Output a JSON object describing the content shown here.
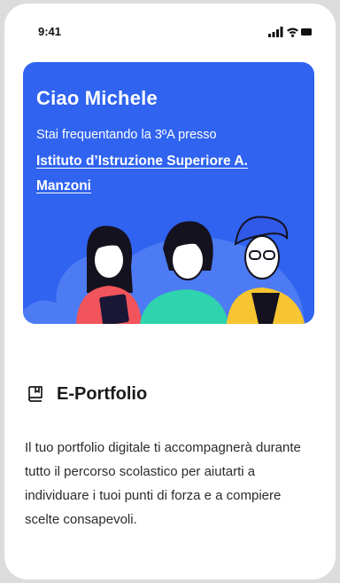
{
  "status_bar": {
    "time": "9:41"
  },
  "hero": {
    "greeting": "Ciao Michele",
    "subtitle": "Stai frequentando la 3ºA presso",
    "school": "Istituto d’Istruzione Superiore A. Manzoni",
    "background": "#2f63f0"
  },
  "section": {
    "icon": "book-bookmark-icon",
    "title": "E-Portfolio",
    "description": "Il tuo portfolio digitale ti accompagnerà durante tutto il percorso scolastico per aiutarti a individuare i tuoi punti di forza e a compiere scelte consapevoli."
  }
}
